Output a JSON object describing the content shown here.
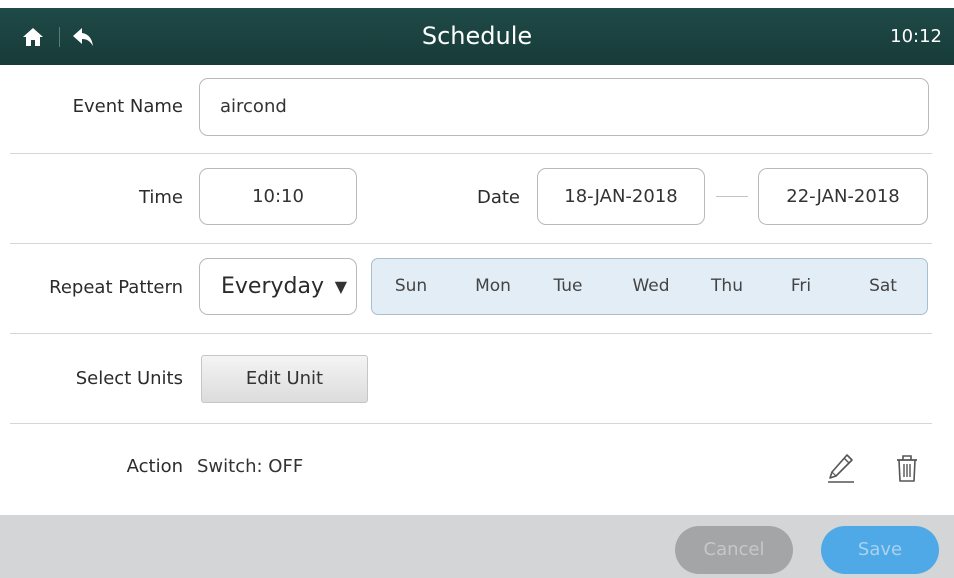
{
  "header": {
    "title": "Schedule",
    "clock": "10:12"
  },
  "event_name": {
    "label": "Event Name",
    "value": "aircond"
  },
  "time": {
    "label": "Time",
    "value": "10:10"
  },
  "date": {
    "label": "Date",
    "start": "18-JAN-2018",
    "end": "22-JAN-2018"
  },
  "repeat": {
    "label": "Repeat Pattern",
    "selected": "Everyday",
    "arrow": "▼",
    "days": [
      "Sun",
      "Mon",
      "Tue",
      "Wed",
      "Thu",
      "Fri",
      "Sat"
    ]
  },
  "units": {
    "label": "Select Units",
    "button": "Edit Unit"
  },
  "action": {
    "label": "Action",
    "value": "Switch: OFF"
  },
  "footer": {
    "cancel": "Cancel",
    "save": "Save"
  },
  "icons": {
    "home": "home-icon",
    "back": "back-icon",
    "edit": "pencil-icon",
    "delete": "trash-icon"
  },
  "colors": {
    "header_bg": "#1f4a47",
    "days_bg": "#e2edf6",
    "save_bg": "#4ea9e6",
    "cancel_bg": "#a3a5a6",
    "footer_bg": "#d3d5d6"
  }
}
